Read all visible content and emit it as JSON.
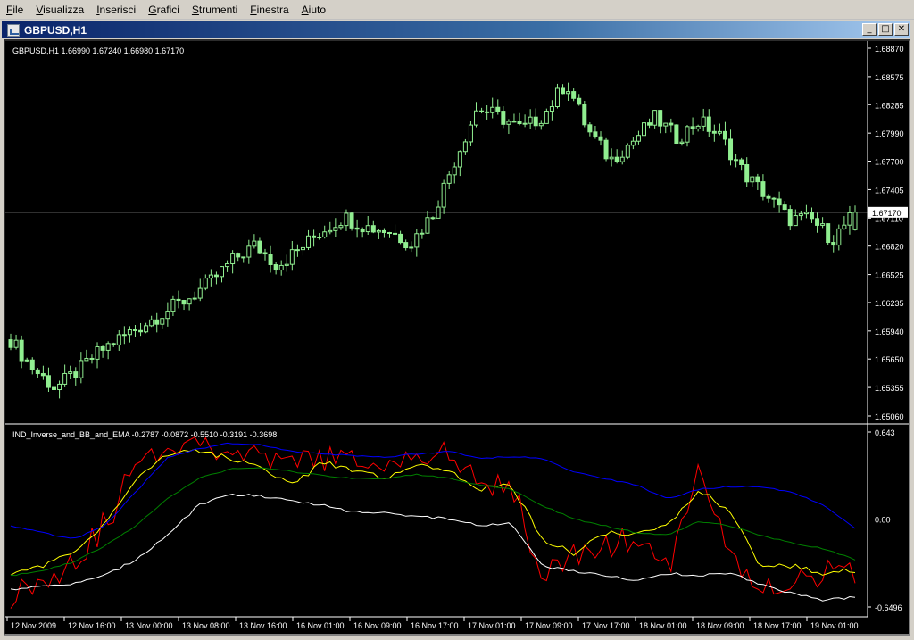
{
  "menubar": {
    "items": [
      "File",
      "Visualizza",
      "Inserisci",
      "Grafici",
      "Strumenti",
      "Finestra",
      "Aiuto"
    ]
  },
  "window": {
    "title": "GBPUSD,H1",
    "buttons": {
      "minimize": "_",
      "restore": "□",
      "close": "✕"
    }
  },
  "colors": {
    "background": "#000000",
    "candle": "#90ee90",
    "grid_text": "#ffffff",
    "bid_line": "#c0c0c0",
    "red_line": "#ff0000",
    "yellow_line": "#ffff00",
    "green_line": "#008000",
    "blue_line": "#0000ff",
    "white_line": "#ffffff"
  },
  "main_chart": {
    "header": "GBPUSD,H1  1.66990 1.67240 1.66980 1.67170",
    "current_price_label": "1.67170",
    "price_ticks": [
      "1.68870",
      "1.68575",
      "1.68285",
      "1.67990",
      "1.67700",
      "1.67405",
      "1.67110",
      "1.66820",
      "1.66525",
      "1.66235",
      "1.65940",
      "1.65650",
      "1.65355",
      "1.65060"
    ]
  },
  "indicator": {
    "header": "IND_Inverse_and_BB_and_EMA -0.2787 -0.0872 -0.5510 -0.3191 -0.3698",
    "ticks": [
      "0.643",
      "0.00",
      "-0.6496"
    ]
  },
  "time_axis": {
    "labels": [
      "12 Nov 2009",
      "12 Nov 16:00",
      "13 Nov 00:00",
      "13 Nov 08:00",
      "13 Nov 16:00",
      "16 Nov 01:00",
      "16 Nov 09:00",
      "16 Nov 17:00",
      "17 Nov 01:00",
      "17 Nov 09:00",
      "17 Nov 17:00",
      "18 Nov 01:00",
      "18 Nov 09:00",
      "18 Nov 17:00",
      "19 Nov 01:00"
    ]
  },
  "chart_data": [
    {
      "type": "candlestick",
      "title": "GBPUSD,H1",
      "ylim": [
        1.6506,
        1.6887
      ],
      "x": [
        "12 Nov 2009",
        "12 Nov 16:00",
        "13 Nov 00:00",
        "13 Nov 08:00",
        "13 Nov 16:00",
        "16 Nov 01:00",
        "16 Nov 09:00",
        "16 Nov 17:00",
        "17 Nov 01:00",
        "17 Nov 09:00",
        "17 Nov 17:00",
        "18 Nov 01:00",
        "18 Nov 09:00",
        "18 Nov 17:00",
        "19 Nov 01:00"
      ],
      "close_path": [
        1.6585,
        1.6555,
        1.6535,
        1.6552,
        1.6573,
        1.6588,
        1.6601,
        1.6615,
        1.6628,
        1.6645,
        1.6668,
        1.6683,
        1.6662,
        1.6679,
        1.6698,
        1.6712,
        1.6702,
        1.6698,
        1.6685,
        1.6716,
        1.6772,
        1.6825,
        1.6816,
        1.6803,
        1.6818,
        1.6852,
        1.6801,
        1.6771,
        1.6791,
        1.6815,
        1.6794,
        1.6812,
        1.6794,
        1.6757,
        1.6735,
        1.671,
        1.671,
        1.6689,
        1.6717
      ],
      "last": {
        "open": 1.6699,
        "high": 1.6724,
        "low": 1.6698,
        "close": 1.6717
      }
    },
    {
      "type": "line",
      "title": "IND_Inverse_and_BB_and_EMA",
      "ylim": [
        -0.6496,
        0.643
      ],
      "series": [
        {
          "color": "#ff0000",
          "values": [
            -0.55,
            -0.45,
            -0.3,
            -0.05,
            0.4,
            0.55,
            0.58,
            0.52,
            0.42,
            0.4,
            0.46,
            0.41,
            0.35,
            0.53,
            0.45,
            0.25,
            0.3,
            -0.45,
            -0.25,
            -0.2,
            -0.15,
            -0.4,
            0.45,
            -0.3,
            -0.5,
            -0.45,
            -0.4,
            -0.4
          ]
        },
        {
          "color": "#ffff00",
          "values": [
            -0.4,
            -0.35,
            -0.25,
            -0.05,
            0.3,
            0.48,
            0.5,
            0.45,
            0.38,
            0.25,
            0.42,
            0.35,
            0.3,
            0.4,
            0.35,
            0.22,
            0.25,
            -0.15,
            -0.25,
            -0.1,
            -0.12,
            -0.05,
            0.22,
            0.05,
            -0.35,
            -0.35,
            -0.4,
            -0.38
          ]
        },
        {
          "color": "#008000",
          "values": [
            -0.42,
            -0.38,
            -0.32,
            -0.2,
            -0.05,
            0.15,
            0.3,
            0.37,
            0.38,
            0.35,
            0.32,
            0.3,
            0.3,
            0.33,
            0.3,
            0.25,
            0.22,
            0.1,
            0.0,
            -0.05,
            -0.1,
            -0.12,
            -0.02,
            -0.05,
            -0.12,
            -0.18,
            -0.22,
            -0.3
          ]
        },
        {
          "color": "#0000ff",
          "values": [
            -0.05,
            -0.1,
            -0.15,
            -0.05,
            0.2,
            0.45,
            0.52,
            0.56,
            0.55,
            0.5,
            0.48,
            0.47,
            0.46,
            0.48,
            0.5,
            0.45,
            0.46,
            0.45,
            0.35,
            0.3,
            0.25,
            0.15,
            0.22,
            0.24,
            0.24,
            0.2,
            0.1,
            -0.07
          ]
        },
        {
          "color": "#ffffff",
          "values": [
            -0.52,
            -0.5,
            -0.48,
            -0.42,
            -0.3,
            -0.12,
            0.1,
            0.18,
            0.17,
            0.14,
            0.1,
            0.05,
            0.05,
            0.02,
            0.0,
            -0.05,
            -0.03,
            -0.35,
            -0.38,
            -0.42,
            -0.45,
            -0.4,
            -0.42,
            -0.4,
            -0.48,
            -0.55,
            -0.6,
            -0.58
          ]
        }
      ]
    }
  ]
}
